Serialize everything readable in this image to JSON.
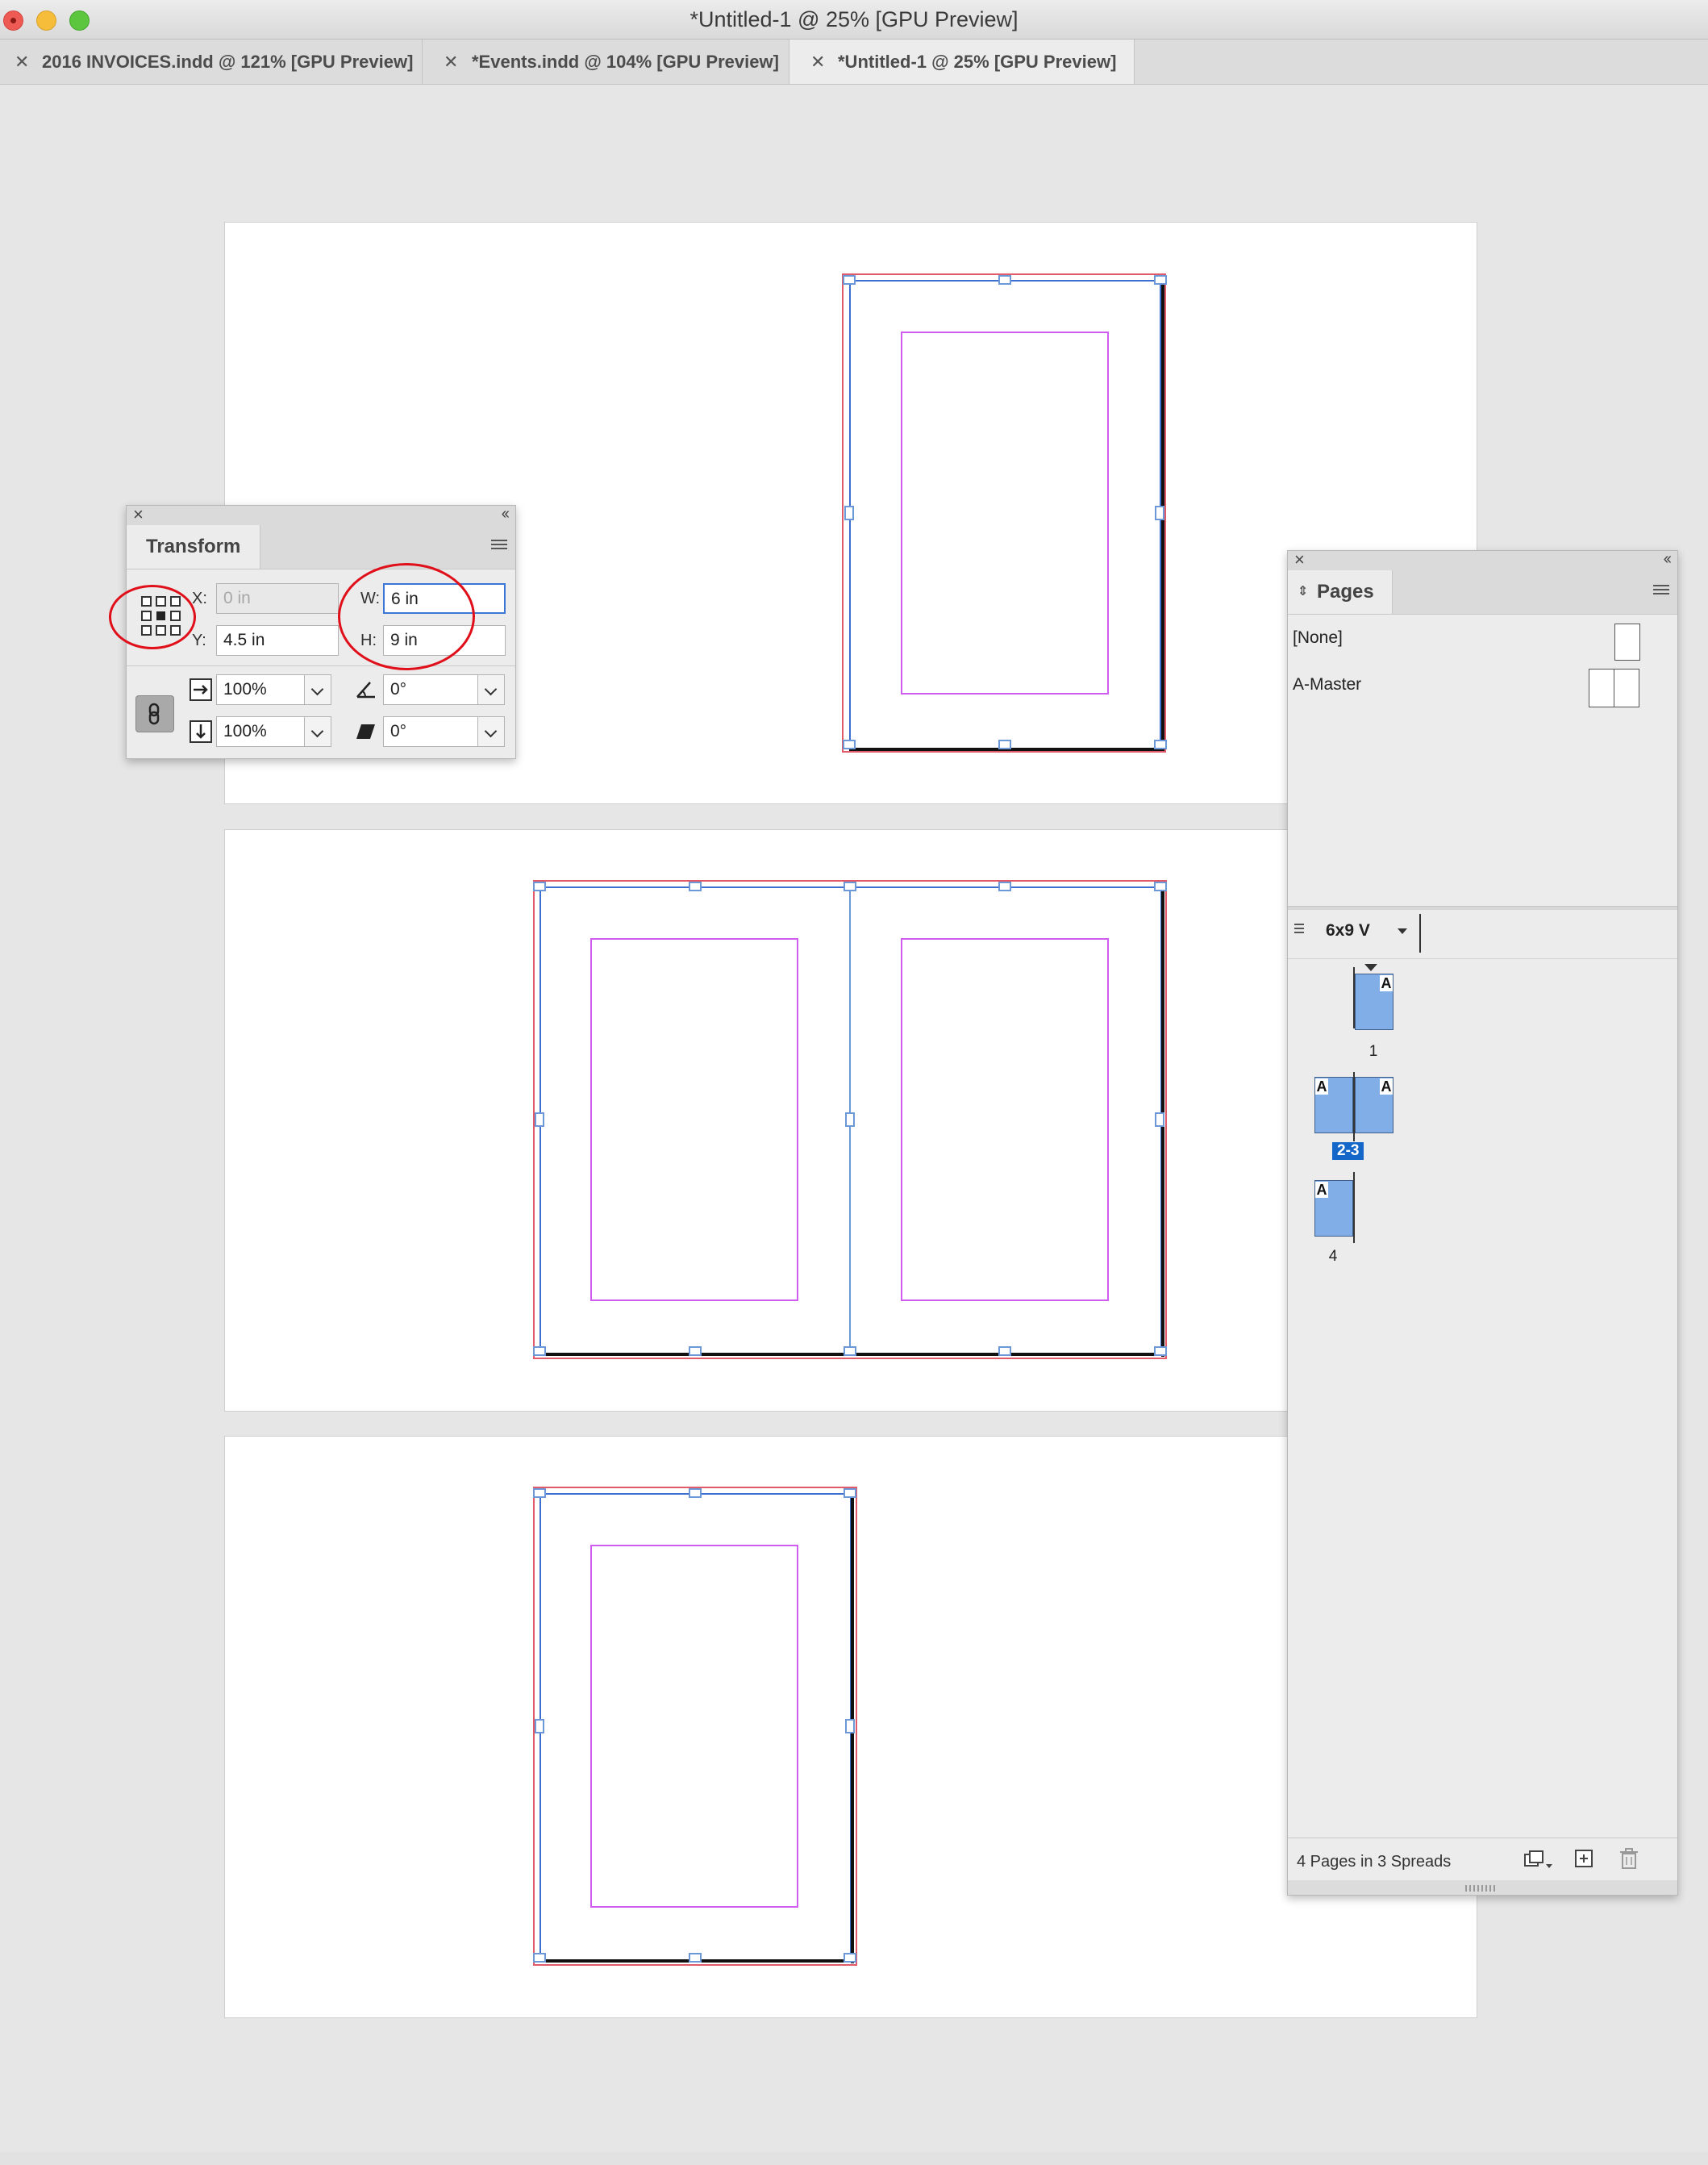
{
  "window": {
    "title": "*Untitled-1 @ 25% [GPU Preview]"
  },
  "tabs": [
    {
      "label": "2016 INVOICES.indd @ 121% [GPU Preview]",
      "active": false
    },
    {
      "label": "*Events.indd @ 104% [GPU Preview]",
      "active": false
    },
    {
      "label": "*Untitled-1 @ 25% [GPU Preview]",
      "active": true
    }
  ],
  "transform_panel": {
    "title": "Transform",
    "x_label": "X:",
    "x_value": "0 in",
    "y_label": "Y:",
    "y_value": "4.5 in",
    "w_label": "W:",
    "w_value": "6 in",
    "h_label": "H:",
    "h_value": "9 in",
    "scale_x": "100%",
    "scale_y": "100%",
    "rotate": "0°",
    "shear": "0°"
  },
  "pages_panel": {
    "title": "Pages",
    "masters": [
      {
        "label": "[None]"
      },
      {
        "label": "A-Master"
      }
    ],
    "page_size": "6x9 V",
    "page_labels": [
      "1",
      "2-3",
      "4"
    ],
    "master_prefix": "A",
    "footer_text": "4 Pages in 3 Spreads"
  },
  "colors": {
    "selection_blue": "#1466c8",
    "page_thumb_blue": "#82aee8",
    "annotation_red": "#e0101a",
    "margin_magenta": "#d05cf0",
    "bleed_red": "#e05a6a"
  }
}
